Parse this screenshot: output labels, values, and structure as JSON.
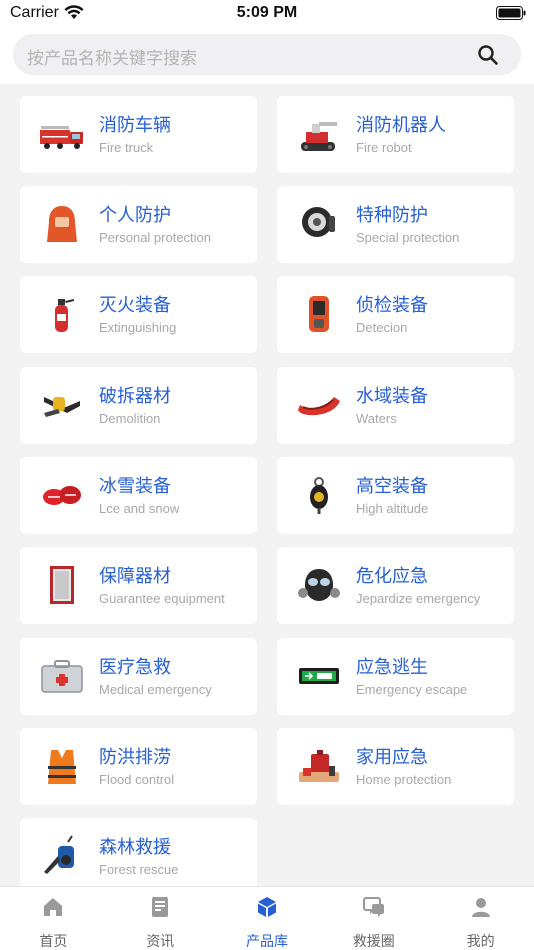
{
  "status_bar": {
    "carrier": "Carrier",
    "time": "5:09 PM"
  },
  "search": {
    "placeholder": "按产品名称关键字搜索"
  },
  "categories": [
    {
      "title": "消防车辆",
      "subtitle": "Fire truck",
      "icon": "fire-truck-icon"
    },
    {
      "title": "消防机器人",
      "subtitle": "Fire robot",
      "icon": "fire-robot-icon"
    },
    {
      "title": "个人防护",
      "subtitle": "Personal protection",
      "icon": "protective-hood-icon"
    },
    {
      "title": "特种防护",
      "subtitle": "Special protection",
      "icon": "special-mask-icon"
    },
    {
      "title": "灭火装备",
      "subtitle": "Extinguishing",
      "icon": "extinguisher-icon"
    },
    {
      "title": "侦检装备",
      "subtitle": "Detecion",
      "icon": "detector-icon"
    },
    {
      "title": "破拆器材",
      "subtitle": "Demolition",
      "icon": "demolition-tool-icon"
    },
    {
      "title": "水域装备",
      "subtitle": "Waters",
      "icon": "rescue-boat-icon"
    },
    {
      "title": "冰雪装备",
      "subtitle": "Lce and snow",
      "icon": "snow-gear-icon"
    },
    {
      "title": "高空装备",
      "subtitle": "High altitude",
      "icon": "pulley-icon"
    },
    {
      "title": "保障器材",
      "subtitle": "Guarantee equipment",
      "icon": "cabinet-icon"
    },
    {
      "title": "危化应急",
      "subtitle": "Jepardize emergency",
      "icon": "gas-mask-icon"
    },
    {
      "title": "医疗急救",
      "subtitle": "Medical emergency",
      "icon": "medical-kit-icon"
    },
    {
      "title": "应急逃生",
      "subtitle": "Emergency escape",
      "icon": "exit-sign-icon"
    },
    {
      "title": "防洪排涝",
      "subtitle": "Flood control",
      "icon": "life-vest-icon"
    },
    {
      "title": "家用应急",
      "subtitle": "Home protection",
      "icon": "home-kit-icon"
    },
    {
      "title": "森林救援",
      "subtitle": "Forest rescue",
      "icon": "leaf-blower-icon"
    }
  ],
  "tabs": [
    {
      "label": "首页",
      "icon": "home-icon",
      "active": false
    },
    {
      "label": "资讯",
      "icon": "news-icon",
      "active": false
    },
    {
      "label": "产品库",
      "icon": "cube-icon",
      "active": true
    },
    {
      "label": "救援圈",
      "icon": "chat-icon",
      "active": false
    },
    {
      "label": "我的",
      "icon": "user-icon",
      "active": false
    }
  ],
  "colors": {
    "accent": "#2760d4",
    "inactive": "#9a9a9a",
    "background": "#f3f3f3"
  }
}
